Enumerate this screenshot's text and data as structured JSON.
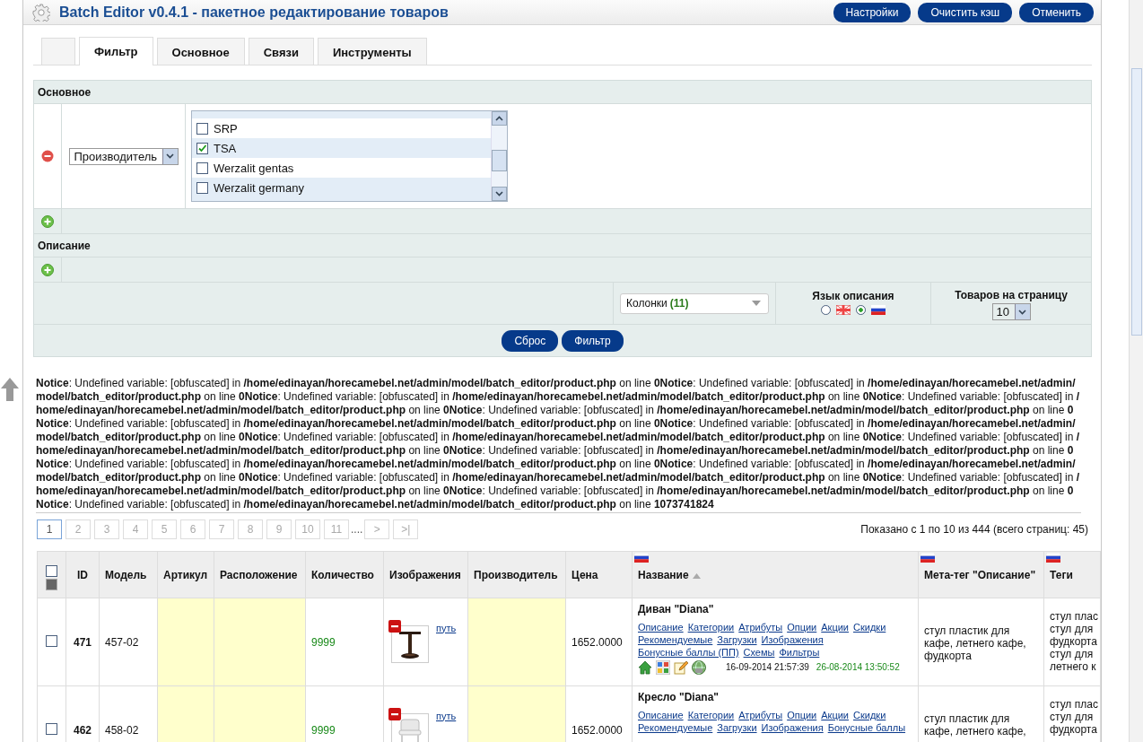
{
  "header": {
    "title": "Batch Editor v0.4.1 - пакетное редактирование товаров",
    "buttons": [
      "Настройки",
      "Очистить кэш",
      "Отменить"
    ]
  },
  "tabs": [
    {
      "label": "Фильтр",
      "selected": true
    },
    {
      "label": "Основное",
      "selected": false
    },
    {
      "label": "Связи",
      "selected": false
    },
    {
      "label": "Инструменты",
      "selected": false
    }
  ],
  "filter": {
    "section_title": "Основное",
    "rule": {
      "field": "Производитель",
      "options": [
        {
          "label": "SRP",
          "checked": false
        },
        {
          "label": "TSA",
          "checked": true
        },
        {
          "label": "Werzalit gentas",
          "checked": false
        },
        {
          "label": "Werzalit germany",
          "checked": false
        }
      ]
    },
    "description_title": "Описание",
    "columns_select": {
      "label": "Колонки",
      "count": "(11)"
    },
    "language": {
      "label": "Язык описания",
      "options": [
        {
          "kind": "en",
          "selected": false
        },
        {
          "kind": "ru",
          "selected": true
        }
      ]
    },
    "per_page": {
      "label": "Товаров на страницу",
      "value": "10"
    },
    "buttons": [
      "Сброс",
      "Фильтр"
    ]
  },
  "notice": "**Notice**: Undefined variable: [obfuscated] in **/home/edinayan/horecamebel.net/admin/model/batch_editor/product.php** on line **0Notice**: Undefined variable: [obfuscated] in **/home/edinayan/horecamebel.net/admin/model/batch_editor/product.php** on line **0Notice**: Undefined variable: [obfuscated] in **/home/edinayan/horecamebel.net/admin/model/batch_editor/product.php** on line **0Notice**: Undefined variable: [obfuscated] in **/home/edinayan/horecamebel.net/admin/model/batch_editor/product.php** on line **0Notice**: Undefined variable: [obfuscated] in **/home/edinayan/horecamebel.net/admin/model/batch_editor/product.php** on line **0Notice**: Undefined variable: [obfuscated] in **/home/edinayan/horecamebel.net/admin/model/batch_editor/product.php** on line **0Notice**: Undefined variable: [obfuscated] in **/home/edinayan/horecamebel.net/admin/model/batch_editor/product.php** on line **0Notice**: Undefined variable: [obfuscated] in **/home/edinayan/horecamebel.net/admin/model/batch_editor/product.php** on line **0Notice**: Undefined variable: [obfuscated] in **/home/edinayan/horecamebel.net/admin/model/batch_editor/product.php** on line **0Notice**: Undefined variable: [obfuscated] in **/home/edinayan/horecamebel.net/admin/model/batch_editor/product.php** on line **0Notice**: Undefined variable: [obfuscated] in **/home/edinayan/horecamebel.net/admin/model/batch_editor/product.php** on line **0Notice**: Undefined variable: [obfuscated] in **/home/edinayan/horecamebel.net/admin/model/batch_editor/product.php** on line **0Notice**: Undefined variable: [obfuscated] in **/home/edinayan/horecamebel.net/admin/model/batch_editor/product.php** on line **0Notice**: Undefined variable: [obfuscated] in **/home/edinayan/horecamebel.net/admin/model/batch_editor/product.php** on line **0Notice**: Undefined variable: [obfuscated] in **/home/edinayan/horecamebel.net/admin/model/batch_editor/product.php** on line **0Notice**: Undefined variable: [obfuscated] in **/home/edinayan/horecamebel.net/admin/model/batch_editor/product.php** on line **1073741824**",
  "pagination": {
    "pages": [
      {
        "label": "1",
        "selected": true
      },
      {
        "label": "2",
        "selected": false
      },
      {
        "label": "3",
        "selected": false
      },
      {
        "label": "4",
        "selected": false
      },
      {
        "label": "5",
        "selected": false
      },
      {
        "label": "6",
        "selected": false
      },
      {
        "label": "7",
        "selected": false
      },
      {
        "label": "8",
        "selected": false
      },
      {
        "label": "9",
        "selected": false
      },
      {
        "label": "10",
        "selected": false
      },
      {
        "label": "11",
        "selected": false
      }
    ],
    "ellipsis": "....",
    "next": ">",
    "last": ">|",
    "summary": "Показано с 1 по 10 из 444 (всего страниц: 45)"
  },
  "table": {
    "columns": [
      {
        "label": "ID",
        "flag": false,
        "sorted": false
      },
      {
        "label": "Модель",
        "flag": false,
        "sorted": false
      },
      {
        "label": "Артикул",
        "flag": false,
        "sorted": false
      },
      {
        "label": "Расположение",
        "flag": false,
        "sorted": false
      },
      {
        "label": "Количество",
        "flag": false,
        "sorted": false
      },
      {
        "label": "Изображения",
        "flag": false,
        "sorted": false
      },
      {
        "label": "Производитель",
        "flag": false,
        "sorted": false
      },
      {
        "label": "Цена",
        "flag": false,
        "sorted": false
      },
      {
        "label": "Название",
        "flag": true,
        "sorted": true
      },
      {
        "label": "Мета-тег \"Описание\"",
        "flag": true,
        "sorted": false
      },
      {
        "label": "Теги",
        "flag": true,
        "sorted": false
      }
    ],
    "select_all_checked": false,
    "rows": [
      {
        "checked": false,
        "id": "471",
        "model": "457-02",
        "quantity": "9999",
        "image_link": "путь",
        "price": "1652.0000",
        "name": "Диван \"Diana\"",
        "links": [
          "Описание",
          "Категории",
          "Атрибуты",
          "Опции",
          "Акции",
          "Скидки",
          "Рекомендуемые",
          "Загрузки",
          "Изображения",
          "Бонусные баллы (ПП)",
          "Схемы",
          "Фильтры"
        ],
        "created": "16-09-2014 21:57:39",
        "modified": "26-08-2014 13:50:52",
        "meta": "стул пластик для кафе, летнего кафе, фудкорта",
        "tags": [
          "стул плас",
          "стул для",
          "фудкорта",
          "стул для",
          "летнего к"
        ]
      },
      {
        "checked": false,
        "id": "462",
        "model": "458-02",
        "quantity": "9999",
        "image_link": "путь",
        "price": "1652.0000",
        "name": "Кресло \"Diana\"",
        "links": [
          "Описание",
          "Категории",
          "Атрибуты",
          "Опции",
          "Акции",
          "Скидки",
          "Рекомендуемые",
          "Загрузки",
          "Изображения",
          "Бонусные баллы"
        ],
        "meta": "стул пластик для кафе, летнего кафе,",
        "tags": [
          "стул плас",
          "стул для",
          "фудкорта"
        ]
      }
    ]
  }
}
